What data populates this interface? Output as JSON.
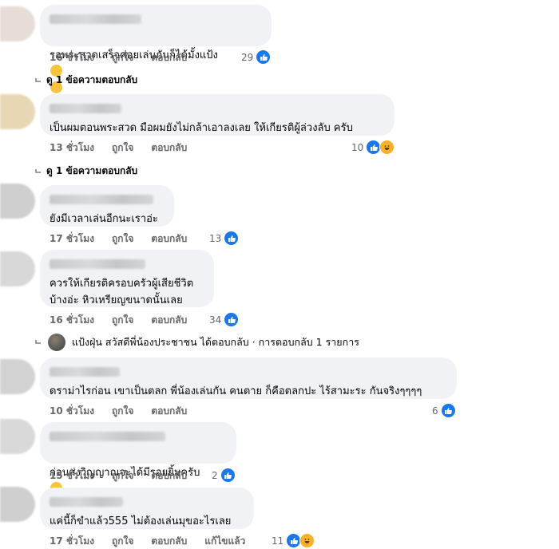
{
  "comments": [
    {
      "text": "รอพระสวดเสร็จค่อยเล่นกันก็ได้มั้งแป้ง",
      "time": "16 ชั่วโมง",
      "like": "ถูกใจ",
      "reply": "ตอบกลับ",
      "reaction_count": "29",
      "view_replies": "ดู 1 ข้อความตอบกลับ"
    },
    {
      "text": "เป็นผมตอนพระสวด มือผมยังไม่กล้าเอาลงเลย ให้เกียรติผู้ล่วงลับ ครับ",
      "time": "13 ชั่วโมง",
      "like": "ถูกใจ",
      "reply": "ตอบกลับ",
      "reaction_count": "10",
      "view_replies": "ดู 1 ข้อความตอบกลับ"
    },
    {
      "text": "ยังมีเวลาเล่นอีกนะเราอ่ะ",
      "time": "17 ชั่วโมง",
      "like": "ถูกใจ",
      "reply": "ตอบกลับ",
      "reaction_count": "13"
    },
    {
      "text": "ควรให้เกียรติครอบครัวผู้เสียชีวิต\nบ้างอ่ะ หิวเหรียญขนาดนั้นเลย",
      "time": "16 ชั่วโมง",
      "like": "ถูกใจ",
      "reply": "ตอบกลับ",
      "reaction_count": "34",
      "reply_preview": "แป้งฝุ่น สวัสดีพี่น้องประชาชน ได้ตอบกลับ · การตอบกลับ 1 รายการ"
    },
    {
      "text": "ดราม่าไรก่อน เขาเป็นตลก พี่น้องเล่นกัน คนตาย ก็คือตลกปะ ไร้สามะระ กันจริงๆๆๆๆ",
      "time": "10 ชั่วโมง",
      "like": "ถูกใจ",
      "reply": "ตอบกลับ",
      "reaction_count": "6"
    },
    {
      "text": "ก่อนส่งวิญญาณจะได้มีรอยยิ้มครับ",
      "time": "15 ชั่วโมง",
      "like": "ถูกใจ",
      "reply": "ตอบกลับ",
      "reaction_count": "2"
    },
    {
      "text": "แค่นี้ก็ขำแล้ว555 ไม่ต้องเล่นมุขอะไรเลย",
      "time": "17 ชั่วโมง",
      "like": "ถูกใจ",
      "reply": "ตอบกลับ",
      "edited": "แก้ไขแล้ว",
      "reaction_count": "11"
    }
  ],
  "colors": {
    "bubble": "#f0f2f5",
    "like_blue": "#1877f2",
    "haha_yellow": "#f7b125",
    "meta_gray": "#65676b"
  },
  "icons": [
    "like-icon",
    "haha-icon",
    "reply-arrow-icon",
    "sad-face-emoji",
    "crying-face-emoji"
  ]
}
